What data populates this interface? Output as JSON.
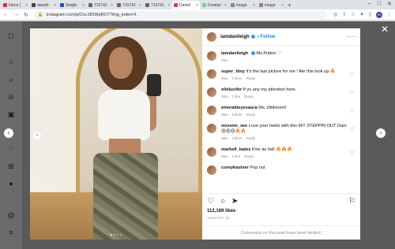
{
  "browser": {
    "tabs": [
      {
        "label": "Inbox (",
        "color": "#d93025",
        "active": false
      },
      {
        "label": "daniell",
        "color": "#444444",
        "active": false
      },
      {
        "label": "Single-",
        "color": "#185abc",
        "active": false
      },
      {
        "label": "715741",
        "color": "#666666",
        "active": false
      },
      {
        "label": "715741",
        "color": "#666666",
        "active": false
      },
      {
        "label": "715741",
        "color": "#666666",
        "active": false
      },
      {
        "label": "Daniel",
        "color": "#e1306c",
        "active": true
      },
      {
        "label": "Freelan",
        "color": "#6fd68b",
        "active": false
      },
      {
        "label": "image",
        "color": "#888888",
        "active": false
      },
      {
        "label": "image",
        "color": "#888888",
        "active": false
      }
    ],
    "new_tab": "+",
    "url": "instagram.com/p/Cnc1fDWpRO7?img_index=1",
    "profile_initials": "M"
  },
  "post": {
    "author": "iamdanileigh",
    "follow_label": "Follow",
    "caption_author": "iamdanileigh",
    "caption": "Ms.Putton ♡",
    "caption_time": "39w",
    "comments": [
      {
        "user": "super_tiiny",
        "text": "It's the last picture for me ! Ate this look up 🔥",
        "time": "39w",
        "likes": "2 likes",
        "reply": "Reply"
      },
      {
        "user": "ellelucifer",
        "text": "If yo any my attention here.",
        "time": "39w",
        "likes": "1 like",
        "reply": "Reply"
      },
      {
        "user": "emeraldeyesaura",
        "text": "Ms. Ditilonem!",
        "time": "39w",
        "likes": "5 likes",
        "reply": "Reply"
      },
      {
        "user": "vixxenn_vee",
        "text": "Love your heels with this fit!!! STEPPIN OUT Dani 😍😍😍🔥🔥",
        "time": "39w",
        "likes": "4 likes",
        "reply": "Reply"
      },
      {
        "user": "markell_bates",
        "text": "Fine as hell 🔥🔥🔥",
        "time": "39w",
        "likes": "1 like",
        "reply": "Reply"
      },
      {
        "user": "coreykastner",
        "text": "Pop out",
        "time": "",
        "likes": "",
        "reply": ""
      }
    ],
    "likes": "112,169 likes",
    "date": "JANUARY 15",
    "limited_notice": "Comments on this post have been limited."
  },
  "icons": {
    "close": "✕",
    "prev": "‹",
    "next": "›"
  }
}
